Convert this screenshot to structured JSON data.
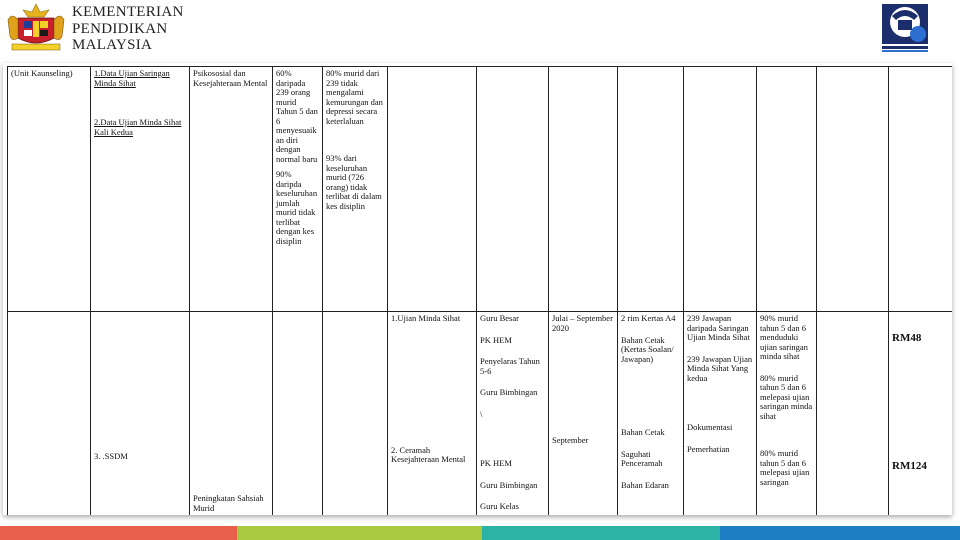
{
  "header": {
    "ministry_line1": "KEMENTERIAN",
    "ministry_line2": "PENDIDIKAN",
    "ministry_line3": "MALAYSIA",
    "left_logo_icon": "malaysia-coat-of-arms-icon",
    "right_logo_icon": "school-25-anniversary-logo-icon"
  },
  "table": {
    "row1": {
      "unit": "(Unit Kaunseling)",
      "program_1": "1.Data Ujian Saringan Minda Sihat",
      "program_2": "2.Data Ujian Minda Sihat Kali Kedua",
      "aspect": "Psikososial dan Kesejahteraan Mental",
      "target_1": "60% daripada 239 orang murid Tahun 5 dan 6 menyesuaikan diri dengan normal baru",
      "target_2": "90% daripda keseluruhan jumlah murid tidak terlibat dengan kes disiplin",
      "achievement_1": "80% murid dari 239 tidak mengalami kemurungan dan depressi secara keterlaluan",
      "achievement_2": "93% dari keseluruhan murid (726 orang) tidak terlibat di dalam kes disiplin"
    },
    "row2": {
      "program": "3. .SSDM",
      "aspect": "Peningkatan Sahsiah Murid",
      "activity_1": "1.Ujian Minda Sihat",
      "activity_2": "2. Ceramah Kesejahteraan Mental",
      "pic_1": "Guru Besar",
      "pic_2": "PK HEM",
      "pic_3": "Penyelaras Tahun 5-6",
      "pic_4": "Guru Bimbingan",
      "pic_5": "\\",
      "pic_6": "PK HEM",
      "pic_7": "Guru Bimbingan",
      "pic_8": "Guru Kelas",
      "date_1": "Julai – September 2020",
      "date_2": "September",
      "input_1": "2 rim Kertas A4",
      "input_2": "Bahan Cetak (Kertas Soalan/ Jawapan)",
      "input_3": "Bahan Cetak",
      "input_4": "Saguhati Penceramah",
      "input_5": "Bahan Edaran",
      "output_1": "239 Jawapan daripada Saringan Ujian Minda Sihat",
      "output_2": "239 Jawapan Ujian Minda Sihat Yang kedua",
      "output_3": "Dokumentasi",
      "output_4": "Pemerhatian",
      "outcome_1": "90% murid tahun 5 dan 6 menduduki ujian saringan minda sihat",
      "outcome_2": "80% murid tahun 5 dan 6 melepasi ujian saringan minda sihat",
      "outcome_3": "80% murid tahun 5 dan 6 melepasi ujian saringan",
      "cost_1": "RM48",
      "cost_2": "RM124"
    }
  },
  "footer_colors": [
    "#e8604c",
    "#a8c940",
    "#2bb3a5",
    "#1f7fc4"
  ]
}
